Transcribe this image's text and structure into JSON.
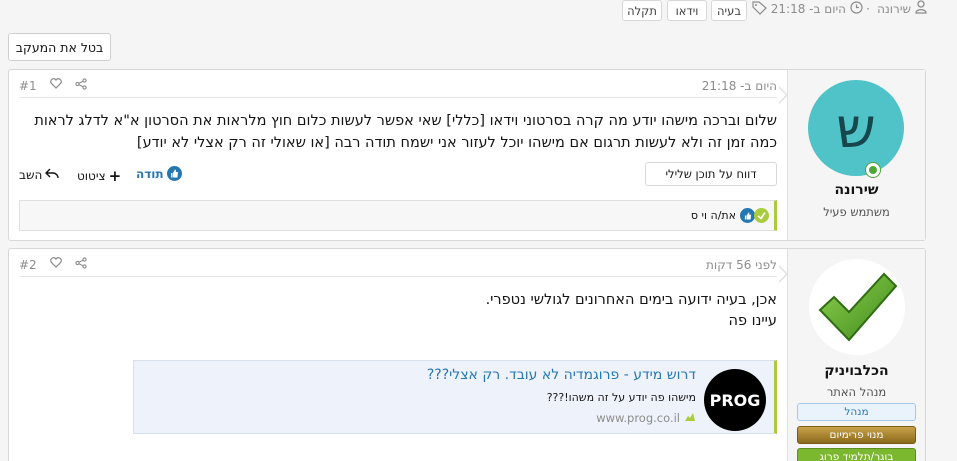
{
  "meta": {
    "author": "שירונה",
    "date": "היום ב- 21:18",
    "tags": [
      "בעיה",
      "וידאו",
      "תקלה"
    ]
  },
  "unwatch_label": "בטל את המעקב",
  "post1": {
    "date": "היום ב- 21:18",
    "number": "#1",
    "avatar_letter": "ש",
    "username": "שירונה",
    "user_title": "משתמש פעיל",
    "body": "שלום וברכה מישהו יודע מה קרה בסרטוני וידאו [כללי] שאי אפשר לעשות כלום חוץ מלראות את הסרטון א\"א לדלג לראות כמה זמן זה ולא לעשות תרגום אם מישהו יוכל לעזור אני ישמח תודה רבה [או שאולי זה רק אצלי לא יודע]",
    "report_label": "דווח על תוכן שלילי",
    "like_label": "תודה",
    "quote_label": "ציטוט",
    "reply_label": "השב",
    "reactions_text": "את/ה וי ס"
  },
  "post2": {
    "date": "לפני 56 דקות",
    "number": "#2",
    "username": "הכלבויניק",
    "user_title": "מנהל האתר",
    "badges": [
      "מנהל",
      "מנוי פרימיום",
      "בוגר/תלמיד פרוג"
    ],
    "body_line1": "אכן, בעיה ידועה בימים האחרונים לגולשי נטפרי.",
    "body_line2": "עיינו פה",
    "embed": {
      "logo_text": "PROG",
      "title": "דרוש מידע - פרוגמדיה לא עובד. רק אצלי???",
      "desc": "מישהו פה יודע על זה משהו!???",
      "site": "www.prog.co.il"
    }
  },
  "colors": {
    "link": "#2577b1",
    "accent": "#a9cc3c",
    "avatar_bg": "#4fc3c8"
  }
}
